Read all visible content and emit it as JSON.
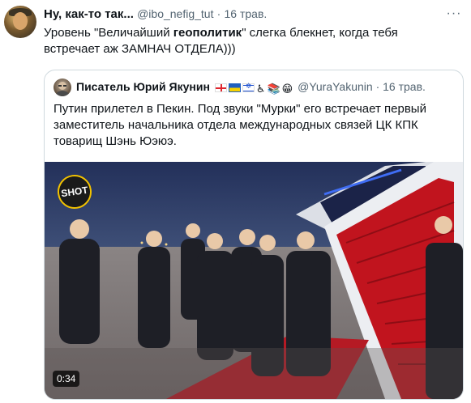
{
  "tweet": {
    "display_name": "Ну, как-то так...",
    "handle": "@ibo_nefig_tut",
    "separator": "·",
    "date": "16 трав.",
    "more_icon": "more-dots-icon",
    "more_symbol": "···",
    "text_part1": "Уровень \"Величайший ",
    "text_bold": "геополитик",
    "text_part2": "\" слегка блекнет, когда тебя встречает аж ЗАМНАЧ ОТДЕЛА)))"
  },
  "quoted": {
    "display_name": "Писатель Юрий Якунин",
    "name_emojis": [
      "flag-georgia",
      "flag-ukraine",
      "flag-israel",
      "wheelchair",
      "books",
      "grinning-face"
    ],
    "handle": "@YuraYakunin",
    "separator": "·",
    "date": "16 трав.",
    "text": "Путин прилетел в Пекин. Под звуки \"Мурки\" его встречает первый заместитель начальника отдела международных связей ЦК КПК товарищ Шэнь Юэюэ.",
    "video": {
      "badge": "SHOT",
      "duration": "0:34"
    }
  },
  "colors": {
    "text_primary": "#0f1419",
    "text_secondary": "#536471",
    "border": "#cfd9de",
    "carpet": "#b51a24",
    "sky": "#2b3a63"
  }
}
